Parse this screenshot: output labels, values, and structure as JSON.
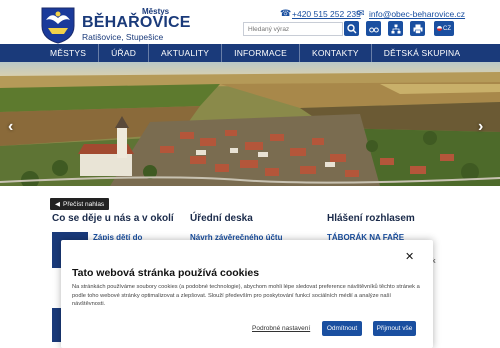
{
  "header": {
    "brand_small": "Městys",
    "brand_title": "BĚHAŘOVICE",
    "brand_subtitle": "Ratišovice, Stupešice",
    "phone": "+420 515 252 235",
    "email": "info@obec-beharovice.cz",
    "search_placeholder": "Hledaný výraz",
    "lang_label": "CZ"
  },
  "nav": {
    "items": [
      "MĚSTYS",
      "ÚŘAD",
      "AKTUALITY",
      "INFORMACE",
      "KONTAKTY",
      "DĚTSKÁ SKUPINA"
    ]
  },
  "read_aloud": "Přečíst nahlas",
  "sections": [
    {
      "title": "Co se děje u nás a v okolí",
      "link": "Zápis dětí do"
    },
    {
      "title": "Úřední deska",
      "link": "Návrh závěrečného účtu"
    },
    {
      "title": "Hlášení rozhlasem",
      "link": "TÁBORÁK NA FAŘE"
    }
  ],
  "side_fragment": "k",
  "cookie": {
    "title": "Tato webová stránka používá cookies",
    "text": "Na stránkách používáme soubory cookies (a podobné technologie), abychom mohli lépe sledovat preference návštěvníků těchto stránek a podle toho webové stránky optimalizovat a zlepšovat. Slouží především pro poskytování funkcí sociálních médií a analýze naší návštěvnosti.",
    "settings_link": "Podrobné nastavení",
    "reject": "Odmítnout",
    "accept": "Přijmout vše"
  }
}
